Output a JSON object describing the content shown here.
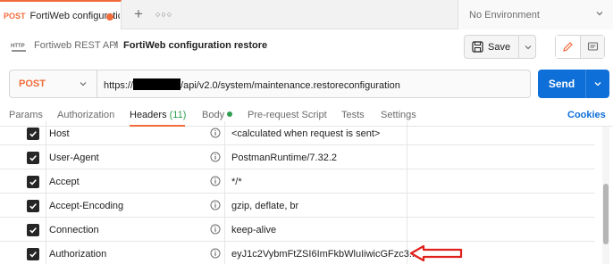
{
  "tab": {
    "method": "POST",
    "title": "FortiWeb configuratic",
    "unsaved_color": "#f26b3a"
  },
  "tabstrip": {
    "new_tab_icon": "plus-icon",
    "more_icon": "more-horizontal-icon"
  },
  "environment": {
    "label": "No Environment"
  },
  "breadcrumb": {
    "icon": "http-icon",
    "collection": "Fortiweb REST API",
    "separator": "/",
    "request": "FortiWeb configuration restore"
  },
  "toolbar": {
    "save_label": "Save"
  },
  "request": {
    "method": "POST",
    "url_prefix": "https://",
    "url_suffix": "/api/v2.0/system/maintenance.restoreconfiguration",
    "send_label": "Send"
  },
  "subtabs": {
    "params": "Params",
    "authorization": "Authorization",
    "headers": "Headers",
    "headers_count": "(11)",
    "body": "Body",
    "prerequest": "Pre-request Script",
    "tests": "Tests",
    "settings": "Settings",
    "cookies": "Cookies"
  },
  "headers": [
    {
      "key": "Host",
      "value": "<calculated when request is sent>",
      "enabled": true
    },
    {
      "key": "User-Agent",
      "value": "PostmanRuntime/7.32.2",
      "enabled": true
    },
    {
      "key": "Accept",
      "value": "*/*",
      "enabled": true
    },
    {
      "key": "Accept-Encoding",
      "value": "gzip, deflate, br",
      "enabled": true
    },
    {
      "key": "Connection",
      "value": "keep-alive",
      "enabled": true
    },
    {
      "key": "Authorization",
      "value": "eyJ1c2VybmFtZSI6ImFkbWluIiwicGFzc3...",
      "enabled": true
    }
  ],
  "colors": {
    "accent": "#f26b3a",
    "send": "#0e6fd8",
    "annotation": "#e0201b",
    "success": "#2f9e4f"
  }
}
